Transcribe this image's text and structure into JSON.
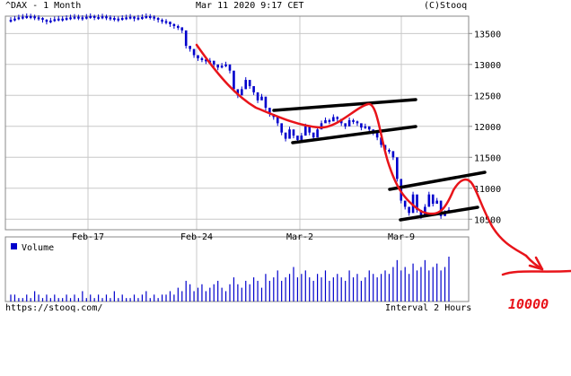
{
  "header": {
    "symbol": "^DAX - 1 Month",
    "datetime": "Mar 11 2020 9:17 CET",
    "source": "(C)Stooq"
  },
  "footer": {
    "url": "https://stooq.com/",
    "interval": "Interval 2 Hours"
  },
  "annotation": {
    "target_label": "10000"
  },
  "colors": {
    "price": "#0000cc",
    "volume": "#0000cc",
    "annotation": "#e8141a",
    "channel": "#000000",
    "grid": "#c8c8c8"
  },
  "chart_data": [
    {
      "type": "candlestick",
      "title": "^DAX - 1 Month",
      "x_tick_labels": [
        "Feb-17",
        "Feb-24",
        "Mar-2",
        "Mar-9"
      ],
      "y_tick_values": [
        10500,
        11000,
        11500,
        12000,
        12500,
        13000,
        13500
      ],
      "ylim": [
        10330,
        13780
      ],
      "grid": true,
      "series": [
        {
          "values": [
            13720,
            13740,
            13760,
            13770,
            13780,
            13775,
            13760,
            13750,
            13720,
            13690,
            13710,
            13730,
            13740,
            13735,
            13750,
            13760,
            13770,
            13760,
            13750,
            13770,
            13780,
            13760,
            13765,
            13775,
            13760,
            13750,
            13740,
            13730,
            13750,
            13760,
            13770,
            13740,
            13755,
            13765,
            13780,
            13770,
            13750,
            13720,
            13700,
            13690,
            13650,
            13620,
            13600,
            13550,
            13300,
            13250,
            13150,
            13100,
            13080,
            13050,
            13060,
            13000,
            12950,
            12980,
            13000,
            12900,
            12600,
            12500,
            12600,
            12750,
            12650,
            12550,
            12420,
            12480,
            12300,
            12200,
            12150,
            12050,
            11900,
            11800,
            11950,
            11850,
            11780,
            11850,
            12000,
            11900,
            11820,
            11950,
            12050,
            12100,
            12080,
            12150,
            12120,
            12050,
            12000,
            12100,
            12080,
            12050,
            11980,
            12000,
            11950,
            11900,
            11820,
            11700,
            11620,
            11600,
            11500,
            11150,
            10800,
            10700,
            10600,
            10900,
            10650,
            10550,
            10700,
            10900,
            10750,
            10800,
            10550,
            10600,
            10650
          ]
        }
      ]
    },
    {
      "type": "bar",
      "title": "Volume",
      "legend": [
        "Volume"
      ],
      "values": [
        2,
        2,
        1,
        1,
        2,
        1,
        3,
        2,
        1,
        2,
        1,
        2,
        1,
        1,
        2,
        1,
        2,
        1,
        3,
        1,
        2,
        1,
        2,
        1,
        2,
        1,
        3,
        1,
        2,
        1,
        1,
        2,
        1,
        2,
        3,
        1,
        2,
        1,
        2,
        2,
        3,
        2,
        4,
        3,
        6,
        5,
        3,
        4,
        5,
        3,
        4,
        5,
        6,
        4,
        3,
        5,
        7,
        5,
        4,
        6,
        5,
        7,
        6,
        4,
        8,
        6,
        7,
        9,
        6,
        7,
        8,
        10,
        7,
        8,
        9,
        7,
        6,
        8,
        7,
        9,
        6,
        7,
        8,
        7,
        6,
        9,
        7,
        8,
        6,
        7,
        9,
        8,
        7,
        8,
        9,
        8,
        10,
        12,
        9,
        10,
        8,
        11,
        9,
        10,
        12,
        9,
        10,
        11,
        9,
        10,
        13
      ]
    }
  ]
}
